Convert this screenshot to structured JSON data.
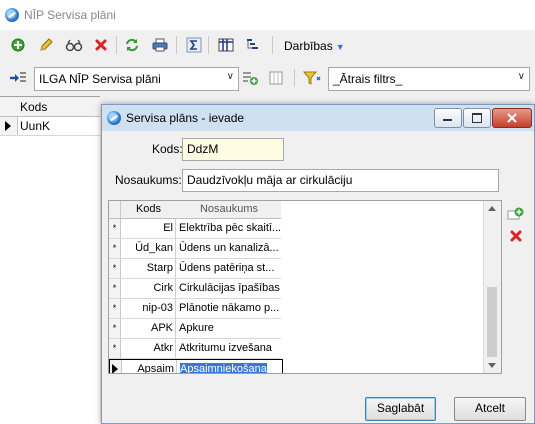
{
  "app": {
    "title": "NĪP Servisa plāni"
  },
  "toolbar": {
    "actions_label": "Darbības"
  },
  "filters": {
    "plan_select": "ILGA NĪP Servisa plāni",
    "quick_filter": "_Ātrais filtrs_"
  },
  "left_grid": {
    "header": "Kods",
    "rows": [
      {
        "kods": "UunK"
      }
    ]
  },
  "dialog": {
    "title": "Servisa plāns - ievade",
    "kods_label": "Kods:",
    "kods_value": "DdzM",
    "name_label": "Nosaukums:",
    "name_value": "Daudzīvokļu māja ar cirkulāciju",
    "grid": {
      "headers": {
        "kods": "Kods",
        "nosaukums": "Nosaukums"
      },
      "rows": [
        {
          "marker": "*",
          "kods": "El",
          "nosaukums": "Elektrība pēc skaitī..."
        },
        {
          "marker": "*",
          "kods": "Ūd_kan",
          "nosaukums": "Ūdens un kanalizā..."
        },
        {
          "marker": "*",
          "kods": "Starp",
          "nosaukums": "Ūdens patēriņa st..."
        },
        {
          "marker": "*",
          "kods": "Cirk",
          "nosaukums": "Cirkulācijas īpašības"
        },
        {
          "marker": "*",
          "kods": "nip-03",
          "nosaukums": "Plānotie nākamo p..."
        },
        {
          "marker": "*",
          "kods": "APK",
          "nosaukums": "Apkure"
        },
        {
          "marker": "*",
          "kods": "Atkr",
          "nosaukums": "Atkritumu izvešana"
        },
        {
          "marker": "",
          "kods": "Apsaim",
          "nosaukums": "Apsaimniekošana"
        }
      ]
    },
    "save_label": "Saglabāt",
    "cancel_label": "Atcelt"
  },
  "colors": {
    "accent": "#3a78d4",
    "title_bar": "#cfe0f3",
    "close_button": "#c4402c"
  }
}
